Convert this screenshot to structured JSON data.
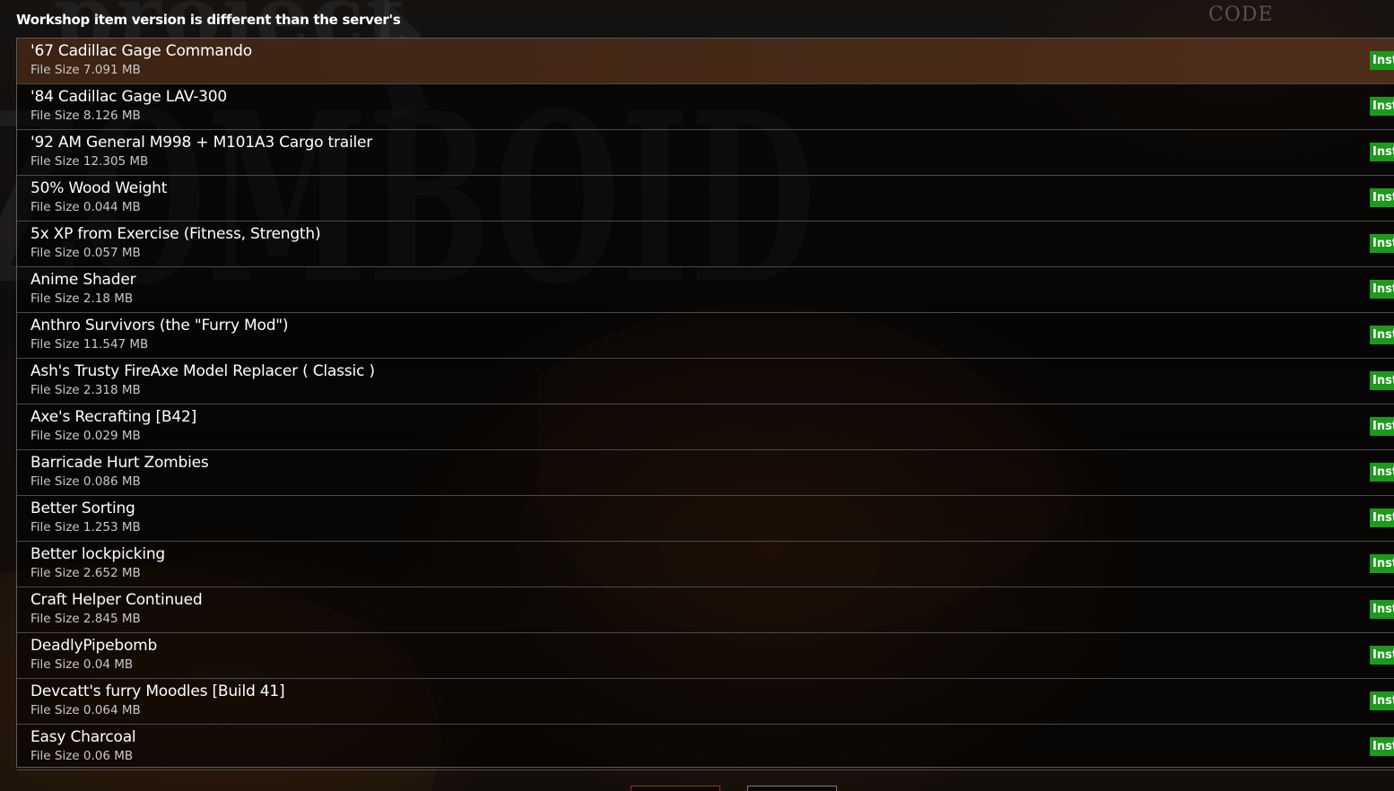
{
  "dialog": {
    "title": "Workshop item version is different than the server's"
  },
  "background": {
    "logo_word_1": "project",
    "logo_word_2": "ZOMBOID",
    "code_label": "CODE"
  },
  "colors": {
    "install_button": "#1c9a1c",
    "selected_row": "#4f2e1a",
    "row_divider": "#4a4a4a"
  },
  "mods": [
    {
      "name": "'67 Cadillac Gage Commando",
      "size": "File Size 7.091 MB",
      "button": "Inst",
      "selected": true
    },
    {
      "name": "'84 Cadillac Gage LAV-300",
      "size": "File Size 8.126 MB",
      "button": "Inst"
    },
    {
      "name": "'92 AM General M998 + M101A3 Cargo trailer",
      "size": "File Size 12.305 MB",
      "button": "Inst"
    },
    {
      "name": "50% Wood Weight",
      "size": "File Size 0.044 MB",
      "button": "Inst"
    },
    {
      "name": "5x XP from Exercise (Fitness, Strength)",
      "size": "File Size 0.057 MB",
      "button": "Inst"
    },
    {
      "name": "Anime Shader",
      "size": "File Size 2.18 MB",
      "button": "Inst"
    },
    {
      "name": "Anthro Survivors (the \"Furry Mod\")",
      "size": "File Size 11.547 MB",
      "button": "Inst"
    },
    {
      "name": "Ash's Trusty FireAxe Model Replacer  ( Classic )",
      "size": "File Size 2.318 MB",
      "button": "Inst"
    },
    {
      "name": "Axe's Recrafting [B42]",
      "size": "File Size 0.029 MB",
      "button": "Inst"
    },
    {
      "name": "Barricade Hurt Zombies",
      "size": "File Size 0.086 MB",
      "button": "Inst"
    },
    {
      "name": "Better Sorting",
      "size": "File Size 1.253 MB",
      "button": "Inst"
    },
    {
      "name": "Better lockpicking",
      "size": "File Size 2.652 MB",
      "button": "Inst"
    },
    {
      "name": "Craft Helper Continued",
      "size": "File Size 2.845 MB",
      "button": "Inst"
    },
    {
      "name": "DeadlyPipebomb",
      "size": "File Size 0.04 MB",
      "button": "Inst"
    },
    {
      "name": "Devcatt's furry Moodles [Build 41]",
      "size": "File Size 0.064 MB",
      "button": "Inst"
    },
    {
      "name": "Easy Charcoal",
      "size": "File Size 0.06 MB",
      "button": "Inst"
    }
  ]
}
